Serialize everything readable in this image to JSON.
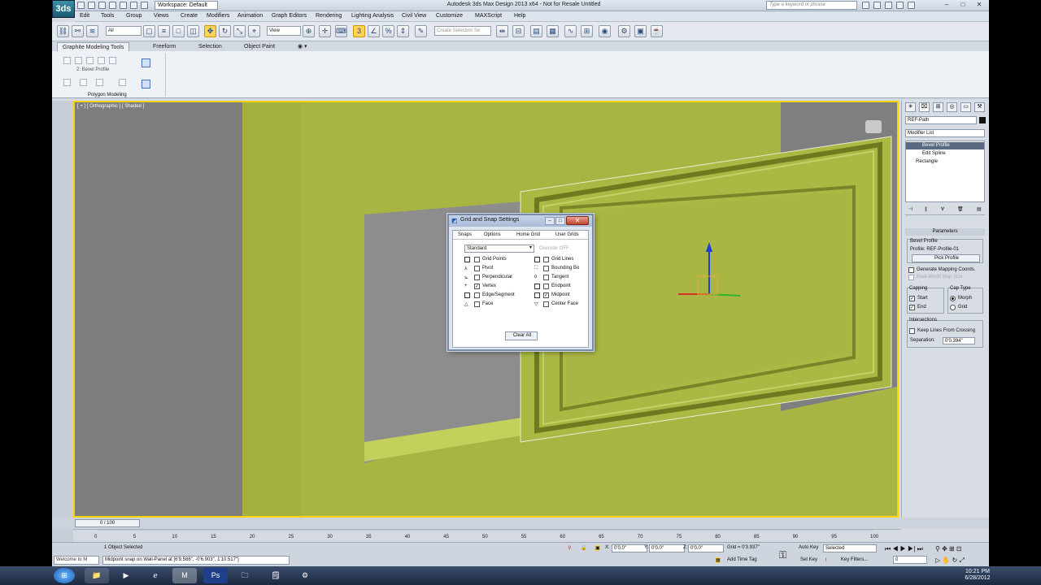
{
  "titlebar": {
    "title": "Autodesk 3ds Max Design 2013 x64  -  Not for Resale    Untitled",
    "workspace": "Workspace: Default",
    "search_placeholder": "Type a keyword or phrase",
    "app_button": "3ds"
  },
  "menu": [
    "Edit",
    "Tools",
    "Group",
    "Views",
    "Create",
    "Modifiers",
    "Animation",
    "Graph Editors",
    "Rendering",
    "Lighting Analysis",
    "Civil View",
    "Customize",
    "MAXScript",
    "Help"
  ],
  "toolbar": {
    "selection_filter": "All",
    "ref_coord": "View",
    "named_selection_placeholder": "Create Selection Se"
  },
  "ribbon": {
    "tabs": [
      "Graphite Modeling Tools",
      "Freeform",
      "Selection",
      "Object Paint"
    ],
    "level_label": "2: Bevel Profile",
    "panel_label": "Polygon Modeling"
  },
  "viewport": {
    "label": "[ + ] [ Orthographic ] [ Shaded ]"
  },
  "dialog": {
    "title": "Grid and Snap Settings",
    "tabs": [
      "Snaps",
      "Options",
      "Home Grid",
      "User Grids"
    ],
    "preset": "Standard",
    "override": "Override OFF",
    "left_snaps": [
      {
        "label": "Grid Points",
        "checked": ""
      },
      {
        "label": "Pivot",
        "checked": ""
      },
      {
        "label": "Perpendicular",
        "checked": ""
      },
      {
        "label": "Vertex",
        "checked": "✓"
      },
      {
        "label": "Edge/Segment",
        "checked": ""
      },
      {
        "label": "Face",
        "checked": ""
      }
    ],
    "right_snaps": [
      {
        "label": "Grid Lines",
        "checked": ""
      },
      {
        "label": "Bounding Bo",
        "checked": ""
      },
      {
        "label": "Tangent",
        "checked": ""
      },
      {
        "label": "Endpoint",
        "checked": ""
      },
      {
        "label": "Midpoint",
        "checked": "✓"
      },
      {
        "label": "Center Face",
        "checked": ""
      }
    ],
    "clear_all": "Clear All"
  },
  "command_panel": {
    "object_name": "REF-Path",
    "modifier_list": "Modifier List",
    "stack": [
      "Bevel Profile",
      "Edit Spline",
      "Rectangle"
    ],
    "rollout_title": "Parameters",
    "bevel_profile_label": "Bevel Profile",
    "profile_label": "Profile: REF-Profile-01",
    "pick_profile": "Pick Profile",
    "gen_mapping": "Generate Mapping Coords.",
    "real_world": "Real-World Map Size",
    "capping_label": "Capping",
    "cap_start": "Start",
    "cap_end": "End",
    "cap_type_label": "Cap Type",
    "cap_morph": "Morph",
    "cap_grid": "Grid",
    "intersections_label": "Intersections",
    "keep_lines": "Keep Lines From Crossing",
    "separation_label": "Separation:",
    "separation_value": "0'0.394\""
  },
  "timeline": {
    "frame": "0 / 100",
    "ticks": [
      "0",
      "5",
      "10",
      "15",
      "20",
      "25",
      "30",
      "35",
      "40",
      "45",
      "50",
      "55",
      "60",
      "65",
      "70",
      "75",
      "80",
      "85",
      "90",
      "95",
      "100"
    ]
  },
  "status": {
    "selection": "1 Object Selected",
    "prompt": "Midpoint snap on Wall-Panel at [6'9.586\", -0'6.903\", 1'10.517\"]",
    "welcome": "Welcome to M",
    "x_label": "X:",
    "x_value": "0'0.0\"",
    "y_label": "Y:",
    "y_value": "0'0.0\"",
    "z_label": "Z:",
    "z_value": "0'0.0\"",
    "grid": "Grid = 0'3.937\"",
    "add_time_tag": "Add Time Tag",
    "auto_key": "Auto Key",
    "set_key": "Set Key",
    "selected_mode": "Selected",
    "key_filters": "Key Filters...",
    "frame_field": "0"
  },
  "taskbar": {
    "time": "10:21 PM",
    "date": "6/28/2012"
  },
  "colors": {
    "viewport_active_border": "#ffd400",
    "wall_panel": "#a8b43e",
    "taskbar": "#1b2941"
  }
}
